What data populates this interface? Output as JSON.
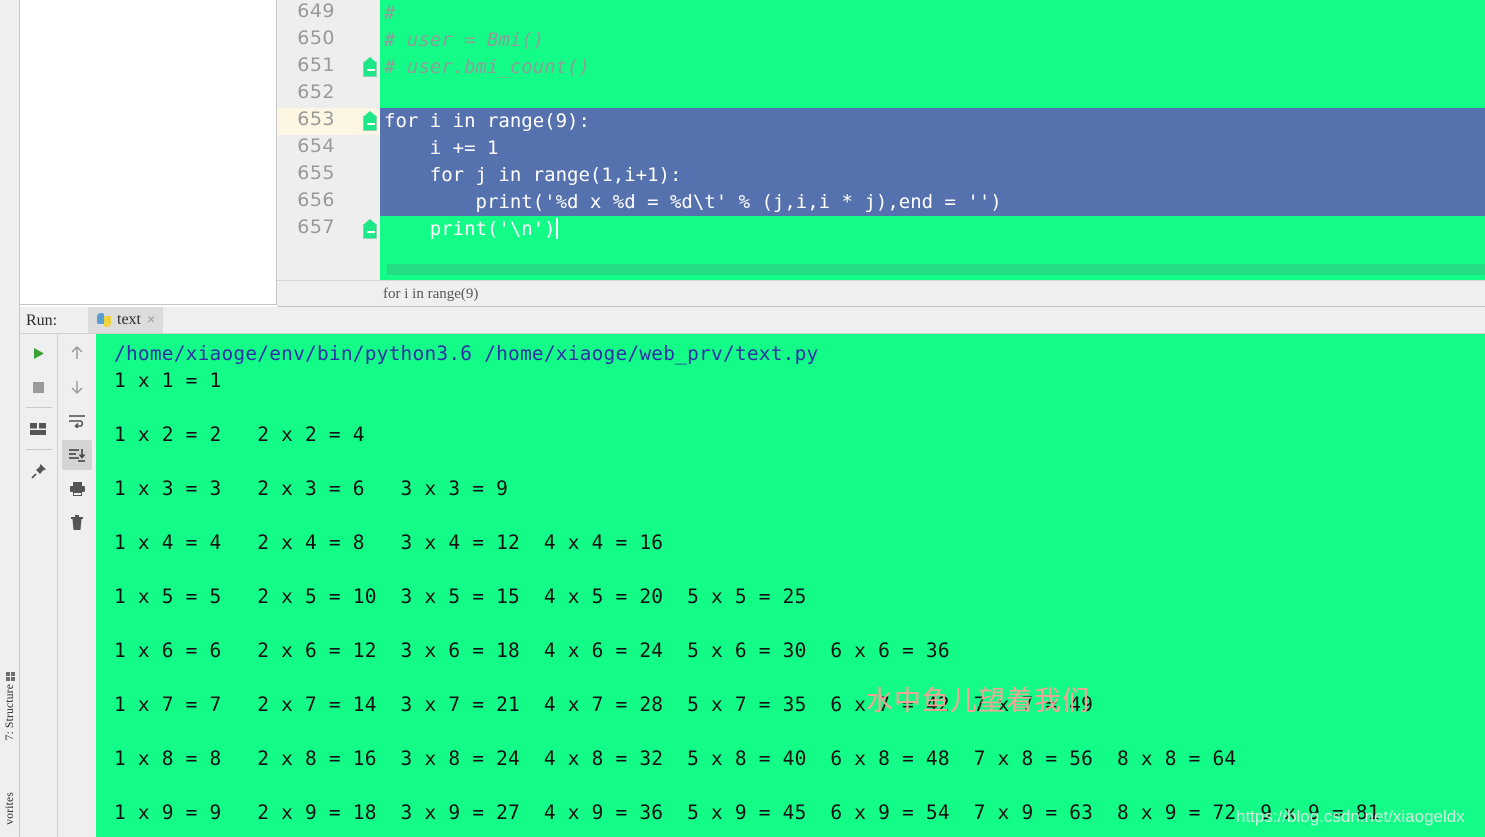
{
  "left_strip": {
    "structure_tool": {
      "label": "7: Structure",
      "icon": "grid-icon"
    },
    "favorites_tool": {
      "label": "vorites",
      "icon": "star-icon"
    }
  },
  "editor": {
    "breadcrumb": "for i in range(9)",
    "line_numbers": [
      "649",
      "650",
      "651",
      "652",
      "653",
      "654",
      "655",
      "656",
      "657"
    ],
    "highlighted_line": "653",
    "lines": [
      {
        "num": "649",
        "text": "#",
        "kind": "comment"
      },
      {
        "num": "650",
        "text": "# user = Bmi()",
        "kind": "comment"
      },
      {
        "num": "651",
        "text": "# user.bmi_count()",
        "kind": "comment",
        "fold": true
      },
      {
        "num": "652",
        "text": "",
        "kind": "blank"
      },
      {
        "num": "653",
        "text": "for i in range(9):",
        "kind": "selected",
        "fold": true
      },
      {
        "num": "654",
        "text": "    i += 1",
        "kind": "selected"
      },
      {
        "num": "655",
        "text": "    for j in range(1,i+1):",
        "kind": "selected"
      },
      {
        "num": "656",
        "text": "        print('%d x %d = %d\\t' % (j,i,i * j),end = '')",
        "kind": "selected"
      },
      {
        "num": "657",
        "text": "    print('\\n')",
        "kind": "selected",
        "fold": true
      }
    ]
  },
  "run_panel": {
    "run_label": "Run:",
    "tab": {
      "name": "text",
      "icon": "python-icon",
      "close": "×"
    },
    "toolbar_left": [
      {
        "name": "rerun-button",
        "icon": "play-icon"
      },
      {
        "name": "stop-button",
        "icon": "stop-icon"
      },
      {
        "name": "layout-button",
        "icon": "layout-icon"
      },
      {
        "name": "pin-button",
        "icon": "pin-icon"
      }
    ],
    "toolbar_right": [
      {
        "name": "up-button",
        "icon": "arrow-up-icon"
      },
      {
        "name": "down-button",
        "icon": "arrow-down-icon"
      },
      {
        "name": "soft-wrap-button",
        "icon": "soft-wrap-icon"
      },
      {
        "name": "scroll-to-end-button",
        "icon": "scroll-end-icon",
        "active": true
      },
      {
        "name": "print-button",
        "icon": "printer-icon"
      },
      {
        "name": "clear-button",
        "icon": "trash-icon"
      }
    ],
    "console": {
      "command": "/home/xiaoge/env/bin/python3.6 /home/xiaoge/web_prv/text.py",
      "output": [
        "1 x 1 = 1",
        "1 x 2 = 2   2 x 2 = 4",
        "1 x 3 = 3   2 x 3 = 6   3 x 3 = 9",
        "1 x 4 = 4   2 x 4 = 8   3 x 4 = 12  4 x 4 = 16",
        "1 x 5 = 5   2 x 5 = 10  3 x 5 = 15  4 x 5 = 20  5 x 5 = 25",
        "1 x 6 = 6   2 x 6 = 12  3 x 6 = 18  4 x 6 = 24  5 x 6 = 30  6 x 6 = 36",
        "1 x 7 = 7   2 x 7 = 14  3 x 7 = 21  4 x 7 = 28  5 x 7 = 35  6 x 7 = 42  7 x 7 = 49",
        "1 x 8 = 8   2 x 8 = 16  3 x 8 = 24  4 x 8 = 32  5 x 8 = 40  6 x 8 = 48  7 x 8 = 56  8 x 8 = 64",
        "1 x 9 = 9   2 x 9 = 18  3 x 9 = 27  4 x 9 = 36  5 x 9 = 45  6 x 9 = 54  7 x 9 = 63  8 x 9 = 72  9 x 9 = 81"
      ]
    }
  },
  "watermarks": {
    "chinese": "水中鱼儿望着我们",
    "url": "https://blog.csdn.net/xiaogeldx"
  },
  "colors": {
    "console_green": "#13fc88",
    "selection_blue": "#5672ae",
    "gutter_gray": "#eeeeee",
    "highlight_line": "#fdf6e3",
    "command_blue": "#2f2fa8",
    "watermark_pink": "#f4a39a"
  }
}
